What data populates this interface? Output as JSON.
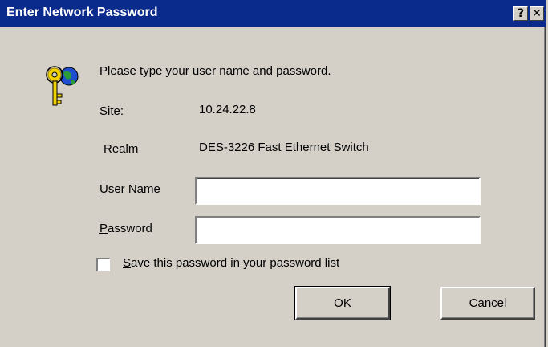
{
  "window": {
    "title": "Enter Network Password",
    "help_button": "?",
    "close_button": "✕"
  },
  "dialog": {
    "prompt": "Please type your user name and password.",
    "site_label": "Site:",
    "site_value": "10.24.22.8",
    "realm_label": "Realm",
    "realm_value": "DES-3226 Fast Ethernet Switch",
    "user_label_mnemonic": "U",
    "user_label_rest": "ser Name",
    "password_label_mnemonic": "P",
    "password_label_rest": "assword",
    "user_value": "",
    "password_value": "",
    "save_mnemonic": "S",
    "save_label_rest": "ave this password in your password list",
    "save_checked": false,
    "ok_label": "OK",
    "cancel_label": "Cancel"
  },
  "icons": {
    "dialog_icon": "key-globe-icon"
  },
  "colors": {
    "titlebar": "#0a2a8c",
    "face": "#d4d0c8"
  }
}
